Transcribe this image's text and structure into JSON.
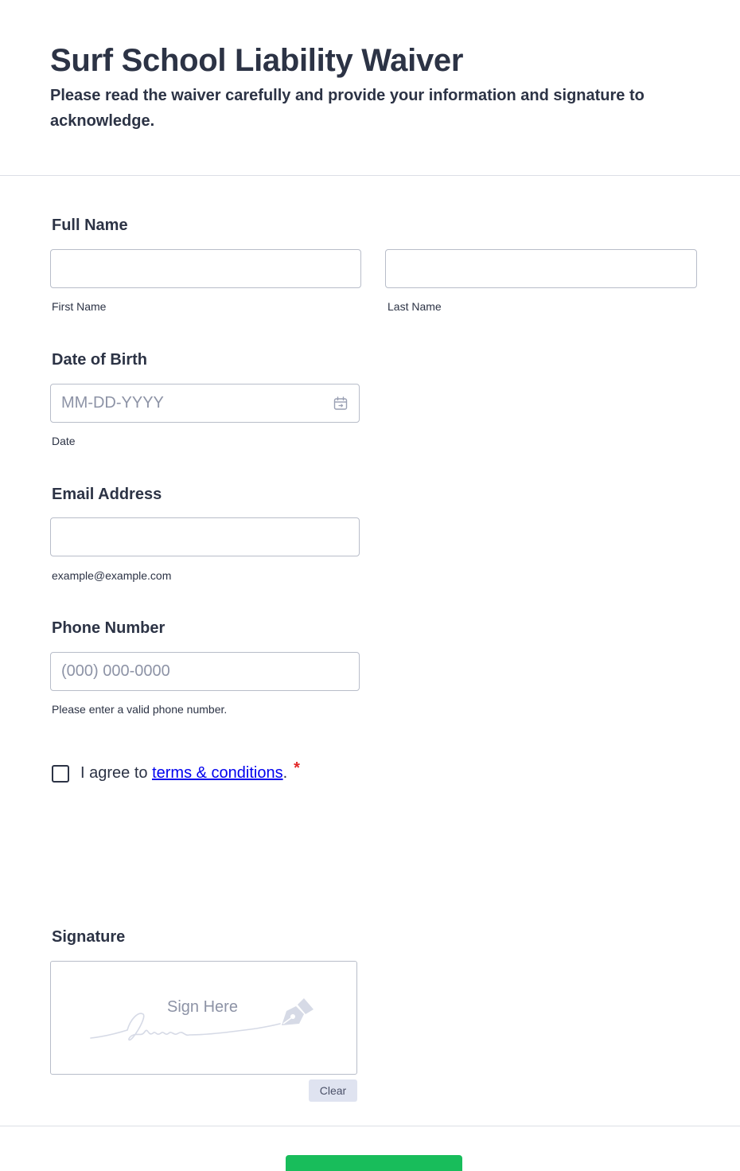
{
  "form": {
    "title": "Surf School Liability Waiver",
    "subtitle": "Please read the waiver carefully and provide your information and signature to acknowledge."
  },
  "full_name": {
    "label": "Full Name",
    "first": {
      "value": "",
      "sublabel": "First Name"
    },
    "last": {
      "value": "",
      "sublabel": "Last Name"
    }
  },
  "dob": {
    "label": "Date of Birth",
    "placeholder": "MM-DD-YYYY",
    "sublabel": "Date",
    "icon": "calendar-icon"
  },
  "email": {
    "label": "Email Address",
    "value": "",
    "sublabel": "example@example.com"
  },
  "phone": {
    "label": "Phone Number",
    "placeholder": "(000) 000-0000",
    "sublabel": "Please enter a valid phone number."
  },
  "terms": {
    "prefix": "I agree to ",
    "link_text": "terms & conditions",
    "suffix": ".",
    "required_mark": "*",
    "checked": false
  },
  "signature": {
    "label": "Signature",
    "pad_text": "Sign Here",
    "clear_label": "Clear",
    "icon": "pen-icon"
  },
  "colors": {
    "text": "#2c3345",
    "placeholder": "#8d93a6",
    "required": "#e32828",
    "link": "#0000ee",
    "submit": "#18bd5b"
  }
}
